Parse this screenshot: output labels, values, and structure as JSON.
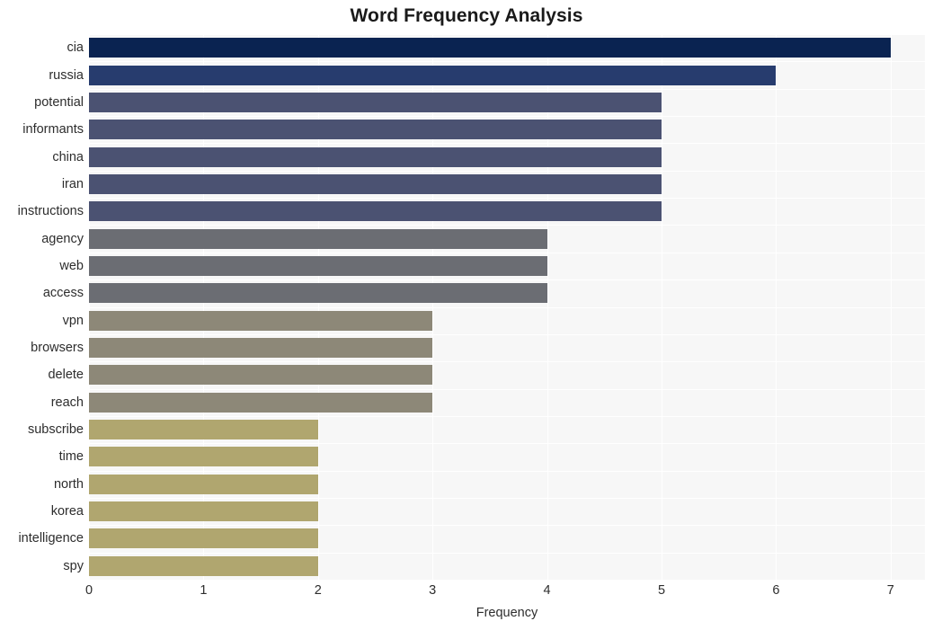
{
  "chart_data": {
    "type": "bar",
    "orientation": "horizontal",
    "title": "Word Frequency Analysis",
    "xlabel": "Frequency",
    "ylabel": "",
    "xlim": [
      0,
      7.3
    ],
    "xticks": [
      "0",
      "1",
      "2",
      "3",
      "4",
      "5",
      "6",
      "7"
    ],
    "xtick_values": [
      0,
      1,
      2,
      3,
      4,
      5,
      6,
      7
    ],
    "grid": true,
    "grid_axis": "x",
    "legend": "none",
    "plot_background": "#f7f7f7",
    "figure_background": "#ffffff",
    "categories": [
      "cia",
      "russia",
      "potential",
      "informants",
      "china",
      "iran",
      "instructions",
      "agency",
      "web",
      "access",
      "vpn",
      "browsers",
      "delete",
      "reach",
      "subscribe",
      "time",
      "north",
      "korea",
      "intelligence",
      "spy"
    ],
    "values": [
      7,
      6,
      5,
      5,
      5,
      5,
      5,
      4,
      4,
      4,
      3,
      3,
      3,
      3,
      2,
      2,
      2,
      2,
      2,
      2
    ],
    "bar_colors": [
      "#0a2351",
      "#273c6e",
      "#4b5272",
      "#4b5272",
      "#4b5272",
      "#4b5272",
      "#4b5272",
      "#6b6d73",
      "#6b6d73",
      "#6b6d73",
      "#8d8878",
      "#8d8878",
      "#8d8878",
      "#8d8878",
      "#b0a66f",
      "#b0a66f",
      "#b0a66f",
      "#b0a66f",
      "#b0a66f",
      "#b0a66f"
    ]
  }
}
